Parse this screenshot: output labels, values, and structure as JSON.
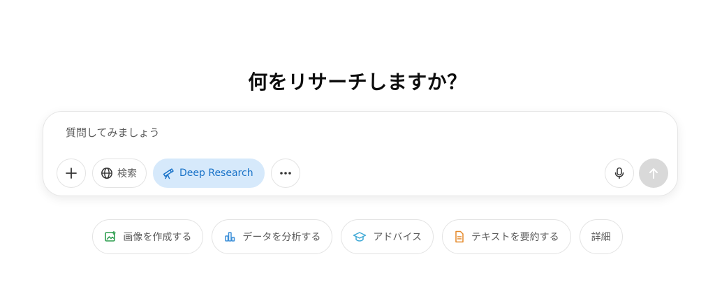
{
  "heading": "何をリサーチしますか？",
  "composer": {
    "placeholder": "質問してみましょう",
    "search_label": "検索",
    "deep_research_label": "Deep Research"
  },
  "suggestions": [
    {
      "label": "画像を作成する",
      "icon": "image-icon",
      "color": "#2e9e4f"
    },
    {
      "label": "データを分析する",
      "icon": "bar-chart-icon",
      "color": "#3b8fd9"
    },
    {
      "label": "アドバイス",
      "icon": "graduation-cap-icon",
      "color": "#3fa9d6"
    },
    {
      "label": "テキストを要約する",
      "icon": "document-icon",
      "color": "#e58a2c"
    },
    {
      "label": "詳細",
      "icon": "",
      "color": ""
    }
  ],
  "colors": {
    "deep_research_bg": "#d6e9fb",
    "deep_research_text": "#1a73c8",
    "send_disabled": "#d9d9d9"
  }
}
